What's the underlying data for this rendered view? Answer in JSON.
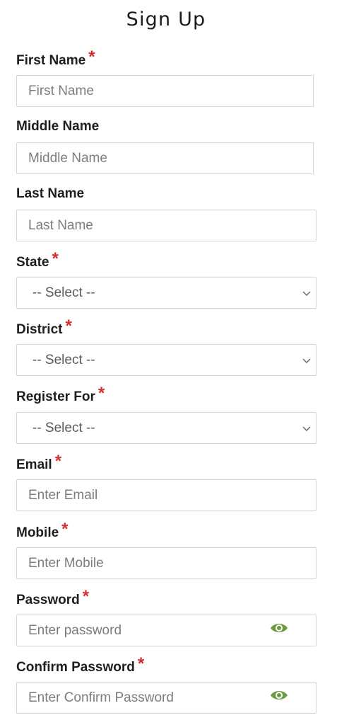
{
  "page": {
    "title": "Sign Up"
  },
  "required_marker": "*",
  "colors": {
    "required": "#d32f2f",
    "eye_icon": "#6e9a3e",
    "border": "#d6d6d6"
  },
  "fields": {
    "first_name": {
      "label": "First Name",
      "placeholder": "First Name",
      "value": ""
    },
    "middle_name": {
      "label": "Middle Name",
      "placeholder": "Middle Name",
      "value": ""
    },
    "last_name": {
      "label": "Last Name",
      "placeholder": "Last Name",
      "value": ""
    },
    "state": {
      "label": "State",
      "selected": "-- Select --",
      "icon": "chevron-down-icon"
    },
    "district": {
      "label": "District",
      "selected": "-- Select --",
      "icon": "chevron-down-icon"
    },
    "register_for": {
      "label": "Register For",
      "selected": "-- Select --",
      "icon": "chevron-down-icon"
    },
    "email": {
      "label": "Email",
      "placeholder": "Enter Email",
      "value": ""
    },
    "mobile": {
      "label": "Mobile",
      "placeholder": "Enter Mobile",
      "value": ""
    },
    "password": {
      "label": "Password",
      "placeholder": "Enter password",
      "value": "",
      "icon": "eye-icon"
    },
    "confirm_password": {
      "label": "Confirm Password",
      "placeholder": "Enter Confirm Password",
      "value": "",
      "icon": "eye-icon"
    }
  }
}
